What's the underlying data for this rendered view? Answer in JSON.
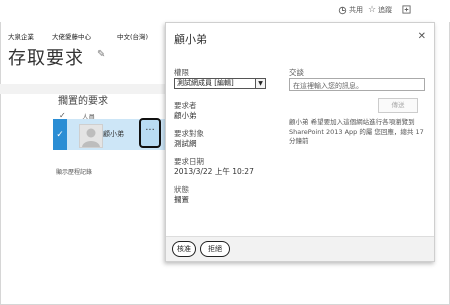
{
  "topbar": {
    "share_label": "共用",
    "follow_label": "追蹤",
    "focus_icon": "focus-icon",
    "share_icon": "share-icon",
    "star_icon": "star-icon"
  },
  "nav": [
    "大泉企業",
    "大佬愛藤中心",
    "中文(台灣)"
  ],
  "page": {
    "title": "存取要求"
  },
  "requests": {
    "heading": "擱置的要求",
    "col_check": "✓",
    "col_name": "人員",
    "rows": [
      {
        "name": "顧小弟",
        "more": "···"
      }
    ],
    "show_history": "顯示歷程記錄"
  },
  "panel": {
    "title": "顧小弟",
    "permission_label": "權限",
    "permission_value": "測試網成員 [編輯]",
    "requester_label": "要求者",
    "requester_value": "顧小弟",
    "target_label": "要求對象",
    "target_value": "測試網",
    "date_label": "要求日期",
    "date_value": "2013/3/22 上午 10:27",
    "status_label": "狀態",
    "status_value": "擱置",
    "conversation_label": "交談",
    "conversation_placeholder": "在這裡輸入您的訊息。",
    "send_label": "傳送",
    "note": "顧小弟 希望要加入這個網站進行各項瀏覽到SharePoint 2013 App 的屬 您回應，總共 17 分鐘前",
    "approve_label": "核准",
    "decline_label": "拒絕"
  },
  "colors": {
    "accent": "#2a8dd4",
    "selection": "#cde6f7"
  }
}
